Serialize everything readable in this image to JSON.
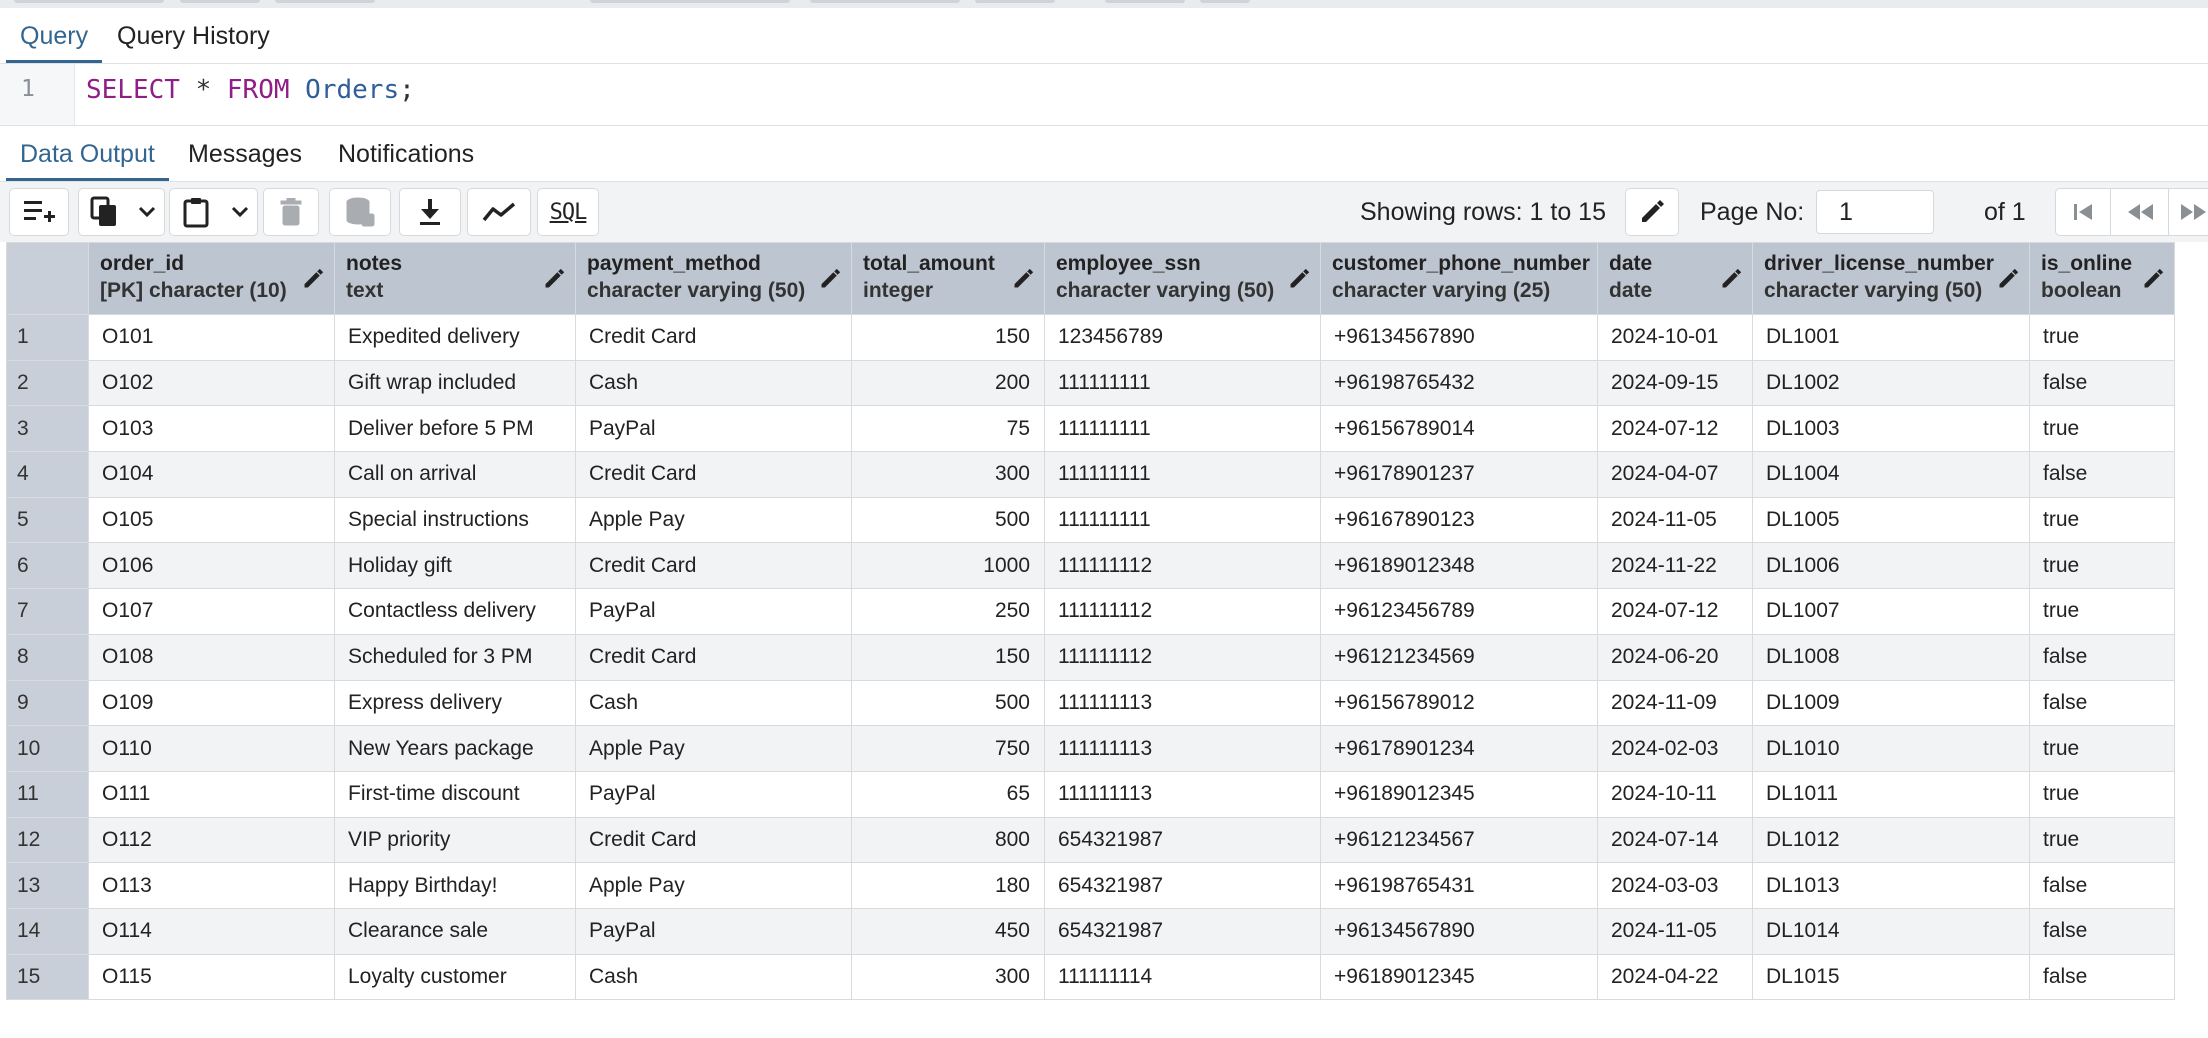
{
  "query_tabs": [
    {
      "label": "Query",
      "active": true
    },
    {
      "label": "Query History",
      "active": false
    }
  ],
  "editor": {
    "line_number": "1",
    "sql": {
      "kw1": "SELECT",
      "star": "*",
      "kw2": "FROM",
      "table": "Orders",
      "semicolon": ";"
    }
  },
  "output_tabs": [
    {
      "label": "Data Output",
      "active": true
    },
    {
      "label": "Messages",
      "active": false
    },
    {
      "label": "Notifications",
      "active": false
    }
  ],
  "toolbar": {
    "icons": [
      "add-row-icon",
      "copy-icon",
      "chevron-down-icon",
      "paste-icon",
      "chevron-down-icon",
      "delete-icon",
      "save-data-icon",
      "download-icon",
      "graph-icon",
      "sql-icon"
    ],
    "sql_label": "SQL",
    "rows_label": "Showing rows: 1 to 15",
    "page_label": "Page No:",
    "page_value": "1",
    "of_label": "of 1"
  },
  "colors": {
    "accent": "#326690",
    "header_bg": "#bdc5d0",
    "row_alt": "#f1f3f5"
  },
  "table": {
    "columns": [
      {
        "name": "order_id",
        "type": "[PK] character (10)"
      },
      {
        "name": "notes",
        "type": "text"
      },
      {
        "name": "payment_method",
        "type": "character varying (50)"
      },
      {
        "name": "total_amount",
        "type": "integer"
      },
      {
        "name": "employee_ssn",
        "type": "character varying (50)"
      },
      {
        "name": "customer_phone_number",
        "type": "character varying (25)"
      },
      {
        "name": "date",
        "type": "date"
      },
      {
        "name": "driver_license_number",
        "type": "character varying (50)"
      },
      {
        "name": "is_online",
        "type": "boolean"
      }
    ],
    "rows": [
      [
        "1",
        "O101",
        "Expedited delivery",
        "Credit Card",
        "150",
        "123456789",
        "+96134567890",
        "2024-10-01",
        "DL1001",
        "true"
      ],
      [
        "2",
        "O102",
        "Gift wrap included",
        "Cash",
        "200",
        "111111111",
        "+96198765432",
        "2024-09-15",
        "DL1002",
        "false"
      ],
      [
        "3",
        "O103",
        "Deliver before 5 PM",
        "PayPal",
        "75",
        "111111111",
        "+96156789014",
        "2024-07-12",
        "DL1003",
        "true"
      ],
      [
        "4",
        "O104",
        "Call on arrival",
        "Credit Card",
        "300",
        "111111111",
        "+96178901237",
        "2024-04-07",
        "DL1004",
        "false"
      ],
      [
        "5",
        "O105",
        "Special instructions",
        "Apple Pay",
        "500",
        "111111111",
        "+96167890123",
        "2024-11-05",
        "DL1005",
        "true"
      ],
      [
        "6",
        "O106",
        "Holiday gift",
        "Credit Card",
        "1000",
        "111111112",
        "+96189012348",
        "2024-11-22",
        "DL1006",
        "true"
      ],
      [
        "7",
        "O107",
        "Contactless delivery",
        "PayPal",
        "250",
        "111111112",
        "+96123456789",
        "2024-07-12",
        "DL1007",
        "true"
      ],
      [
        "8",
        "O108",
        "Scheduled for 3 PM",
        "Credit Card",
        "150",
        "111111112",
        "+96121234569",
        "2024-06-20",
        "DL1008",
        "false"
      ],
      [
        "9",
        "O109",
        "Express delivery",
        "Cash",
        "500",
        "111111113",
        "+96156789012",
        "2024-11-09",
        "DL1009",
        "false"
      ],
      [
        "10",
        "O110",
        "New Years package",
        "Apple Pay",
        "750",
        "111111113",
        "+96178901234",
        "2024-02-03",
        "DL1010",
        "true"
      ],
      [
        "11",
        "O111",
        "First-time discount",
        "PayPal",
        "65",
        "111111113",
        "+96189012345",
        "2024-10-11",
        "DL1011",
        "true"
      ],
      [
        "12",
        "O112",
        "VIP priority",
        "Credit Card",
        "800",
        "654321987",
        "+96121234567",
        "2024-07-14",
        "DL1012",
        "true"
      ],
      [
        "13",
        "O113",
        "Happy Birthday!",
        "Apple Pay",
        "180",
        "654321987",
        "+96198765431",
        "2024-03-03",
        "DL1013",
        "false"
      ],
      [
        "14",
        "O114",
        "Clearance sale",
        "PayPal",
        "450",
        "654321987",
        "+96134567890",
        "2024-11-05",
        "DL1014",
        "false"
      ],
      [
        "15",
        "O115",
        "Loyalty customer",
        "Cash",
        "300",
        "111111114",
        "+96189012345",
        "2024-04-22",
        "DL1015",
        "false"
      ]
    ]
  }
}
